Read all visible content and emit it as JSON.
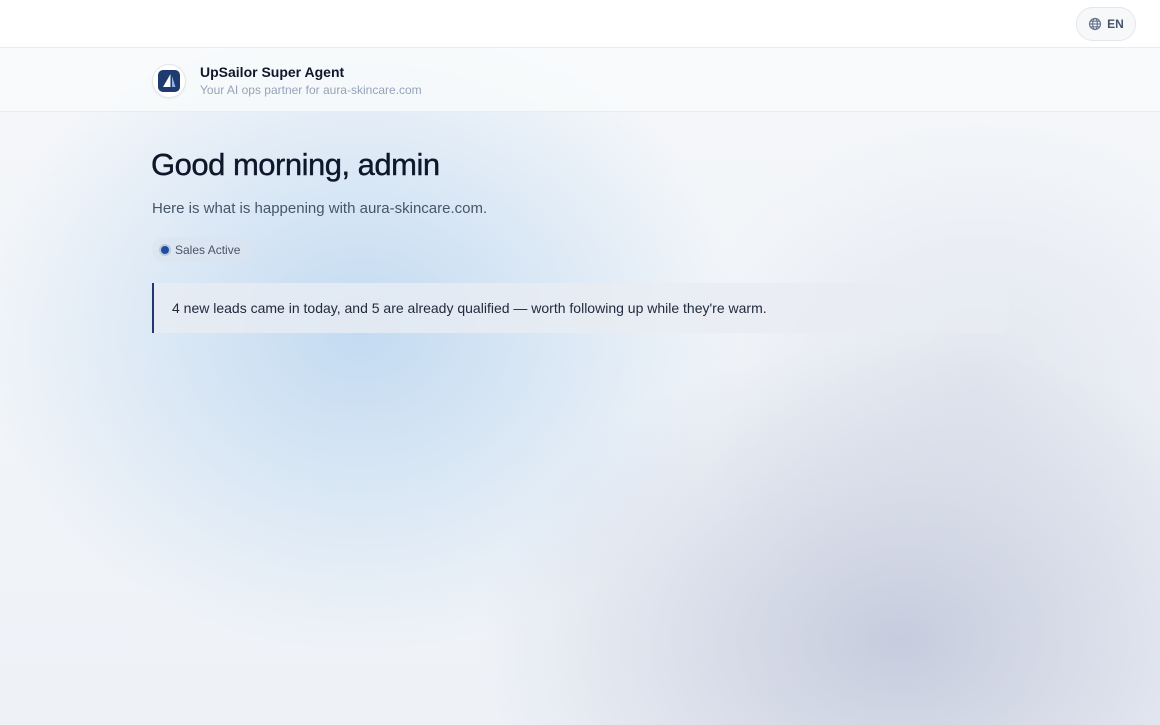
{
  "topbar": {
    "language_label": "EN",
    "language_icon": "globe-icon"
  },
  "agent": {
    "name": "UpSailor Super Agent",
    "tagline": "Your AI ops partner for aura-skincare.com",
    "logo_icon": "sail-logo-icon",
    "brand_color": "#1e3a6e"
  },
  "main": {
    "greeting": "Good morning, admin",
    "subtitle": "Here is what is happening with aura-skincare.com.",
    "status": {
      "label": "Sales Active",
      "dot_color": "#1e4f9a"
    },
    "insight": "4 new leads came in today, and 5 are already qualified — worth following up while they're warm."
  }
}
